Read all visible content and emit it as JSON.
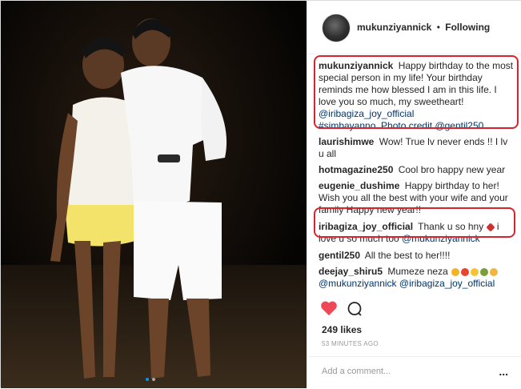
{
  "post": {
    "username": "mukunziyannick",
    "separator": "•",
    "follow_status": "Following",
    "likes": "249 likes",
    "time": "53 MINUTES AGO",
    "comment_placeholder": "Add a comment...",
    "more_label": "...",
    "photo_description": "Couple standing on a beach at night"
  },
  "comments": [
    {
      "user": "mukunziyannick",
      "text": "Happy birthday to the most special person in my life! Your birthday reminds me how blessed I am in this life. I love you so much, my sweetheart!",
      "mention": "@iribagiza_joy_official",
      "extra": "#simbayanno. Photo credit",
      "mention2": "@gentil250"
    },
    {
      "user": "laurishimwe",
      "text": "Wow! True lv never ends !! I lv u all"
    },
    {
      "user": "hotmagazine250",
      "text": "Cool bro happy new year"
    },
    {
      "user": "eugenie_dushime",
      "text": "Happy birthday to her! Wish you all the best with your wife and your family Happy new year!!"
    },
    {
      "user": "iribagiza_joy_official",
      "text": "Thank u so hny",
      "text2": "i love u so much too",
      "mention": "@mukunziyannick"
    },
    {
      "user": "gentil250",
      "text": "All the best to her!!!!"
    },
    {
      "user": "deejay_shiru5",
      "text": "Mumeze neza",
      "mention": "@mukunziyannick",
      "mention2": "@iribagiza_joy_official"
    }
  ],
  "colors": {
    "heart": "#ed4956",
    "highlight": "#d9232b",
    "link": "#003569",
    "text": "#262626",
    "muted": "#999999"
  }
}
